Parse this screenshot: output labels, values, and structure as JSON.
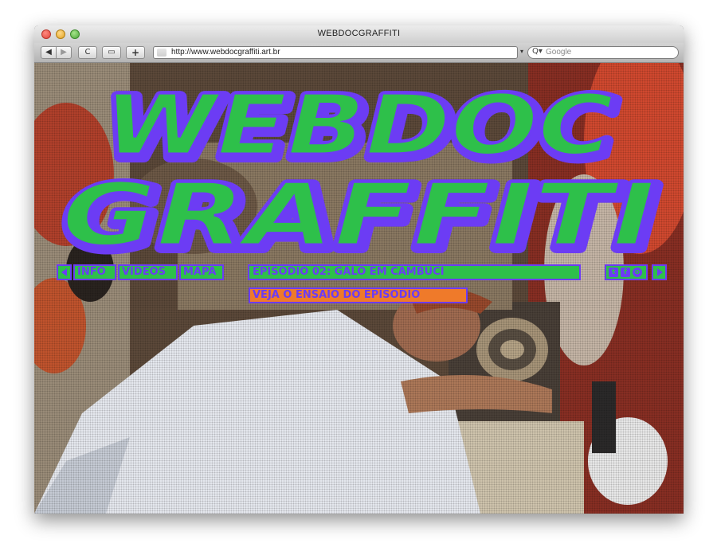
{
  "window": {
    "title": "WEBDOCGRAFFITI"
  },
  "toolbar": {
    "back_label": "◀",
    "forward_label": "▶",
    "reload_label": "C",
    "snapshot_label": "▭",
    "add_label": "+",
    "url": "http://www.webdocgraffiti.art.br",
    "search_placeholder": "Google",
    "search_icon_glyph": "Q▾"
  },
  "site": {
    "logo_line1": "WEBDOC",
    "logo_line2": "GRAFFITI",
    "nav": {
      "info": "INFO",
      "videos": "VIDEOS",
      "mapa": "MAPA"
    },
    "episode_title": "EPISÓDIO 02: GALO EM CAMBUCI",
    "essay_link": "VEJA O ENSAIO DO EPISÓDIO",
    "share_icons": [
      "t",
      "f",
      "o"
    ]
  },
  "colors": {
    "logo_green": "#2ec04a",
    "logo_purple": "#6c3cf4",
    "essay_orange": "#ef7a2a"
  }
}
